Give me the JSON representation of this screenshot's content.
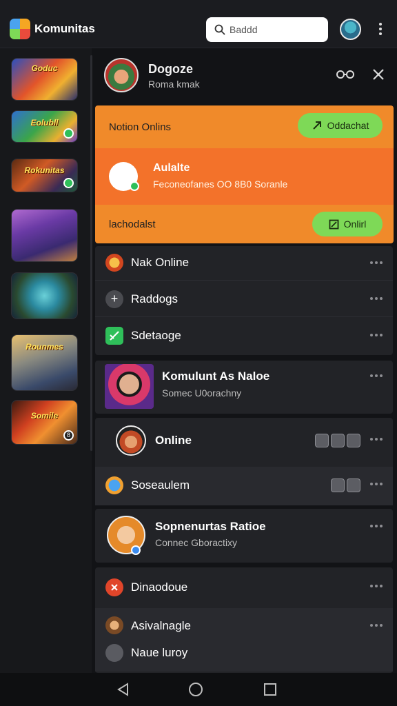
{
  "app": {
    "title": "Komunitas"
  },
  "search": {
    "value": "Baddd"
  },
  "header": {
    "name": "Dogoze",
    "subtitle": "Roma kmak"
  },
  "promo": {
    "notice": "Notion Onlins",
    "download_label": "Oddachat",
    "title": "Aulalte",
    "description": "Feconeofanes OO 8B0 Soranle",
    "footer": "lachodalst",
    "online_label": "Onlirl"
  },
  "menu": {
    "items": [
      {
        "label": "Nak Online",
        "icon": "fire-avatar-icon"
      },
      {
        "label": "Raddogs",
        "icon": "plus-icon"
      },
      {
        "label": "Sdetaoge",
        "icon": "edit-icon"
      }
    ]
  },
  "featured": {
    "name": "Komulunt As Naloe",
    "subtitle": "Somec U0orachny"
  },
  "online_row": {
    "label": "Online"
  },
  "social_row": {
    "label": "Soseaulem"
  },
  "profile_row": {
    "name": "Sopnenurtas Ratioe",
    "subtitle": "Connec Gboractixy"
  },
  "bottom": {
    "items": [
      {
        "label": "Dinaodoue",
        "icon": "red-badge-icon"
      },
      {
        "label": "Asivalnagle",
        "icon": "warrior-avatar-icon"
      },
      {
        "label": "Naue luroy",
        "icon": "gray-badge-icon"
      }
    ]
  },
  "sidebar": {
    "thumbs": [
      {
        "label": "Goduc"
      },
      {
        "label": "Eolubll"
      },
      {
        "label": "Rokunitas"
      },
      {
        "label": ""
      },
      {
        "label": ""
      },
      {
        "label": "Rounmes"
      },
      {
        "label": "Somile",
        "badge": "8"
      }
    ]
  },
  "colors": {
    "accent_orange": "#f08a2a",
    "accent_green": "#7ed957",
    "background": "#121316"
  }
}
